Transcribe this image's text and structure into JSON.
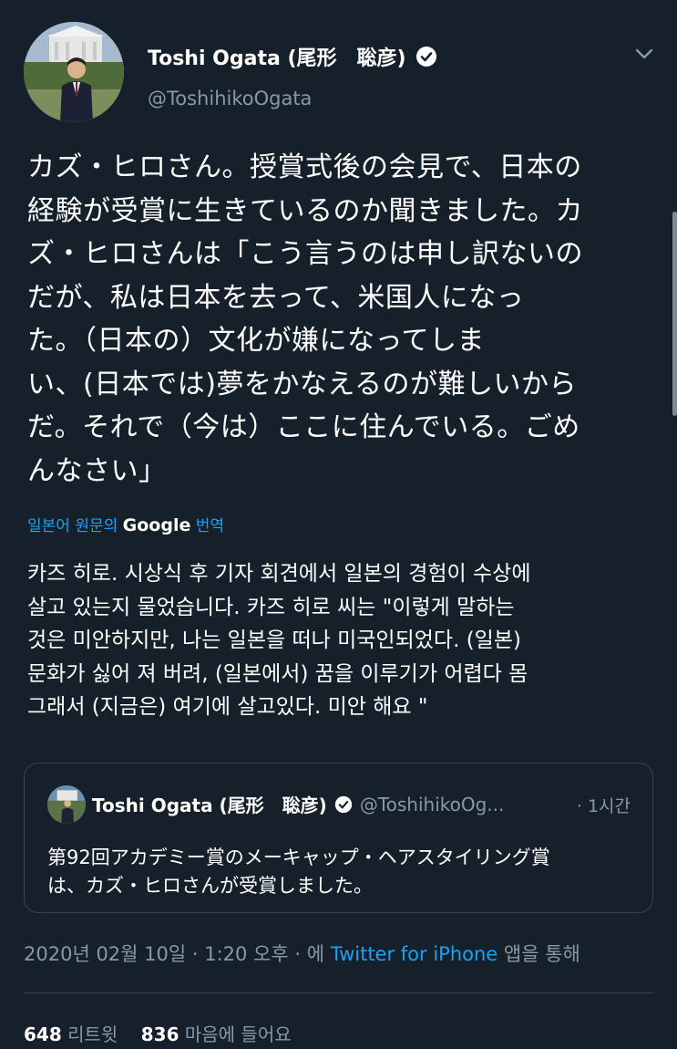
{
  "tweet": {
    "author": {
      "display_name": "Toshi Ogata (尾形　聡彦)",
      "handle": "@ToshihikoOgata",
      "verified_icon": "verified-badge-icon"
    },
    "text": "カズ・ヒロさん。授賞式後の会見で、日本の\n経験が受賞に生きているのか聞きました。カ\nズ・ヒロさんは「こう言うのは申し訳ないの\nだが、私は日本を去って、米国人になっ\nた。（日本の）文化が嫌になってしま\nい、(日本では)夢をかなえるのが難しいから\nだ。それで（今は）ここに住んでいる。ごめ\nんなさい」",
    "translate": {
      "lang_label": "일본어 원문의",
      "provider": "Google",
      "action": "번역"
    },
    "translation": "카즈 히로. 시상식 후 기자 회견에서 일본의 경험이 수상에\n살고 있는지 물었습니다. 카즈 히로 씨는 \"이렇게 말하는\n것은 미안하지만, 나는 일본을 떠나 미국인되었다. (일본)\n문화가 싫어 져 버려, (일본에서) 꿈을 이루기가 어렵다 몸\n그래서 (지금은) 여기에 살고있다. 미안 해요 \"",
    "quoted": {
      "display_name": "Toshi Ogata (尾形　聡彦)",
      "handle": "@ToshihikoOg...",
      "time": "· 1시간",
      "text": "第92回アカデミー賞のメーキャップ・ヘアスタイリング賞\nは、カズ・ヒロさんが受賞しました。"
    },
    "meta": {
      "datetime": "2020년 02월 10일 · 1:20 오후 · 에 ",
      "client": "Twitter for iPhone",
      "suffix": " 앱을 통해"
    },
    "stats": {
      "retweets_count": "648",
      "retweets_label": "리트윗",
      "likes_count": "836",
      "likes_label": "마음에 들어요"
    }
  },
  "colors": {
    "background": "#15202b",
    "secondary_text": "#8899a6",
    "accent": "#1da1f2",
    "border": "#38444d"
  }
}
